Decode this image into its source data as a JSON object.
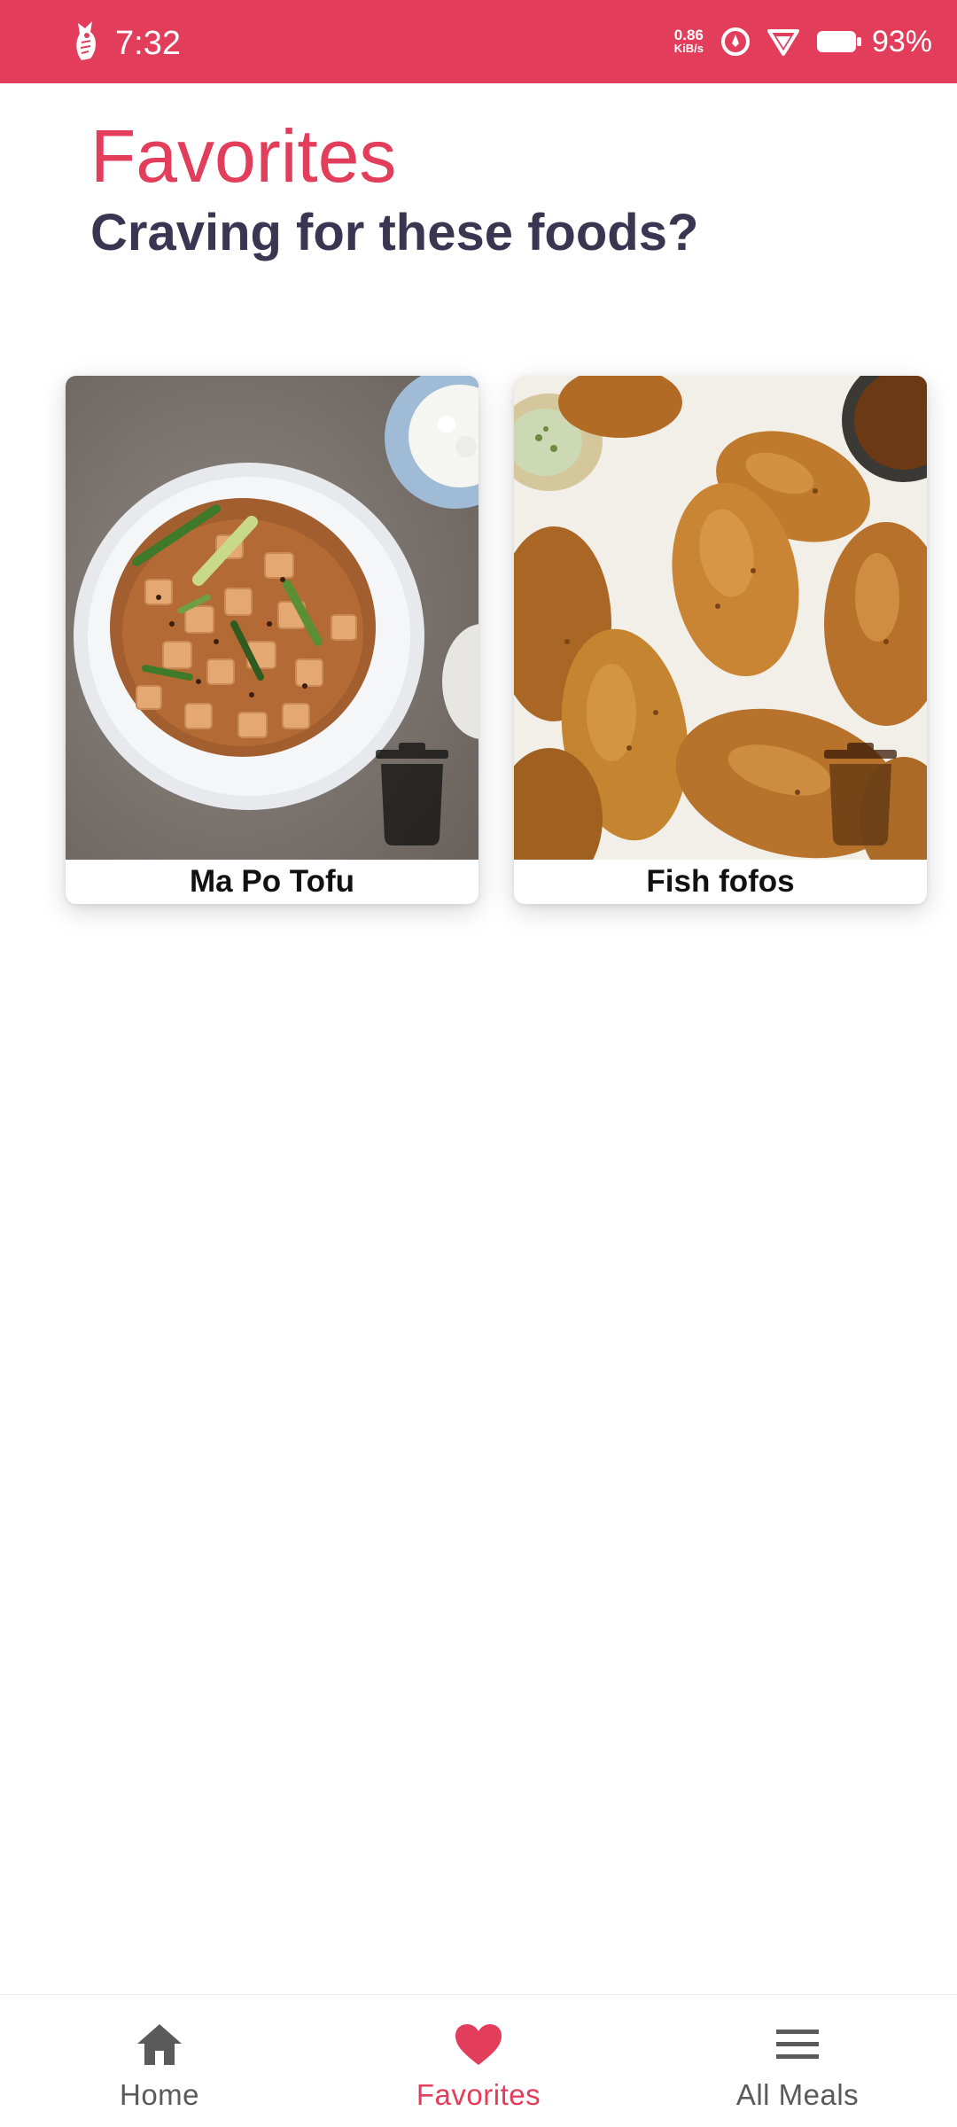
{
  "status_bar": {
    "time": "7:32",
    "net_speed_value": "0.86",
    "net_speed_unit": "KiB/s",
    "battery_percent": "93%",
    "background_color": "#e23d5b",
    "icons": [
      "app-owl-icon",
      "data-saver-icon",
      "wifi-icon",
      "battery-icon"
    ]
  },
  "header": {
    "title": "Favorites",
    "subtitle": "Craving for these foods?",
    "title_color": "#e23d5b",
    "subtitle_color": "#3a3652"
  },
  "favorites": [
    {
      "name": "Ma Po Tofu",
      "image": "mapo-tofu-photo",
      "action_icon": "trash-icon"
    },
    {
      "name": "Fish fofos",
      "image": "fish-fofos-photo",
      "action_icon": "trash-icon"
    }
  ],
  "bottom_nav": {
    "items": [
      {
        "label": "Home",
        "icon": "home-icon",
        "active": false
      },
      {
        "label": "Favorites",
        "icon": "heart-icon",
        "active": true
      },
      {
        "label": "All Meals",
        "icon": "menu-icon",
        "active": false
      }
    ],
    "active_color": "#e23d5b",
    "inactive_color": "#5a5a5a"
  }
}
